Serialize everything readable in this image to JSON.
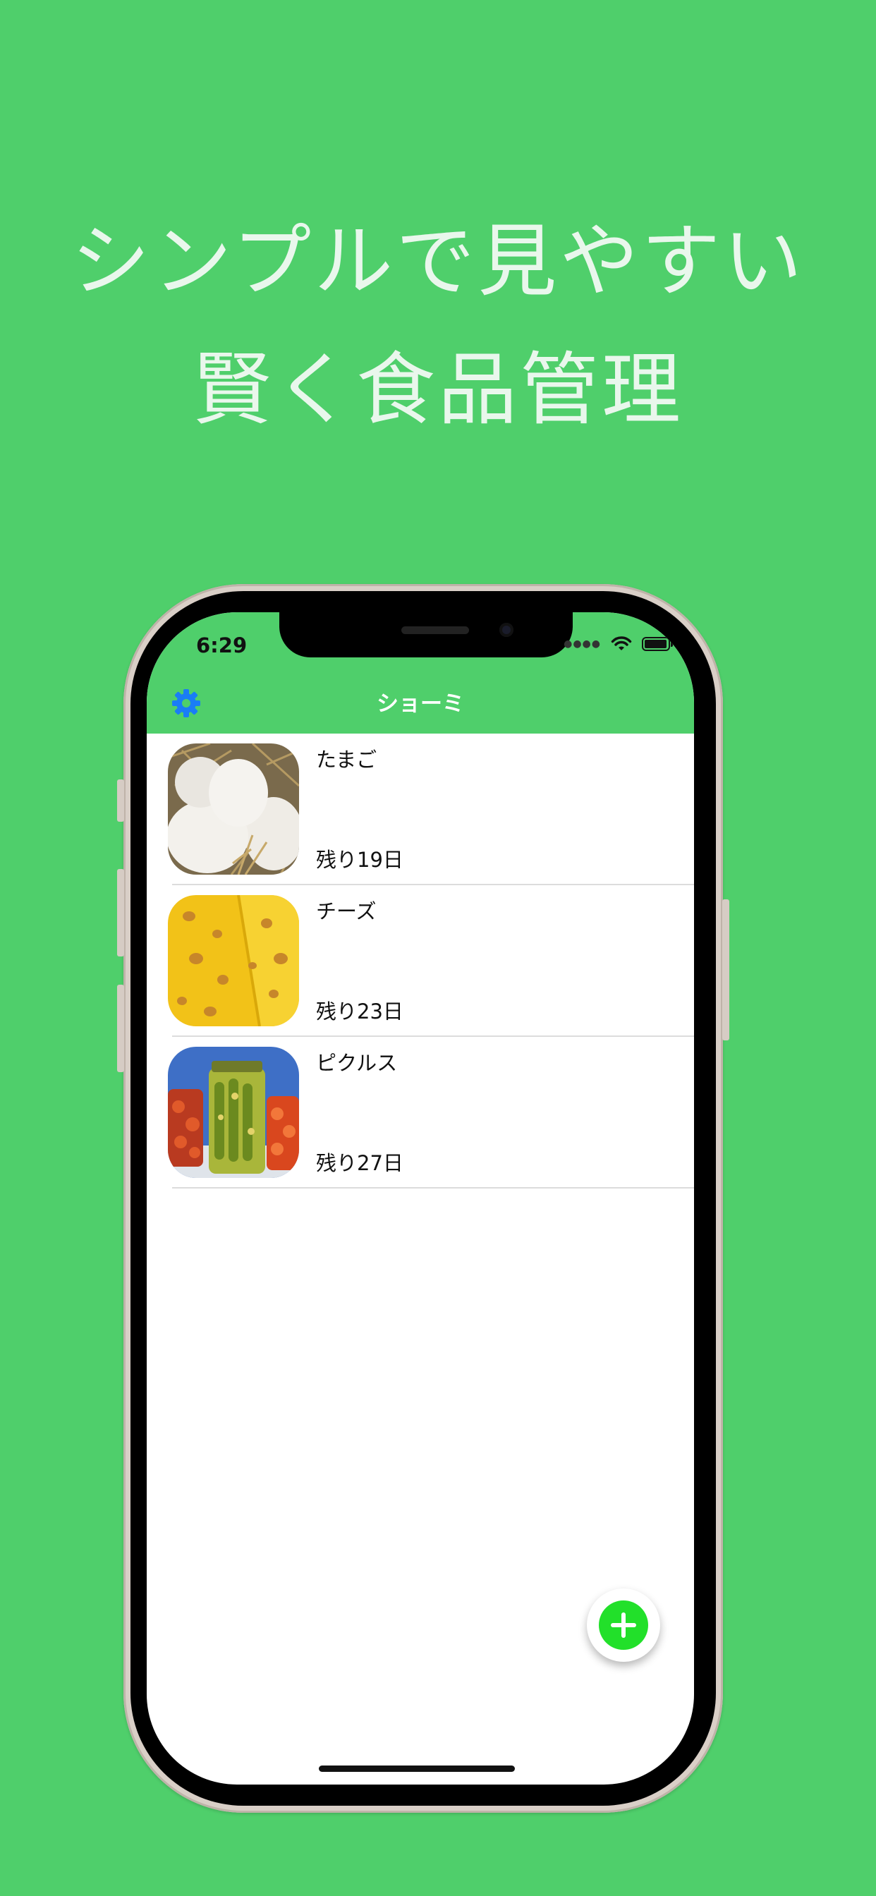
{
  "promo": {
    "line1": "シンプルで見やすい",
    "line2": "賢く食品管理"
  },
  "status_bar": {
    "time": "6:29"
  },
  "nav": {
    "title": "ショーミ",
    "settings_icon": "gear-icon"
  },
  "items": [
    {
      "name": "たまご",
      "remaining": "残り19日",
      "image": "eggs-photo"
    },
    {
      "name": "チーズ",
      "remaining": "残り23日",
      "image": "cheese-photo"
    },
    {
      "name": "ピクルス",
      "remaining": "残り27日",
      "image": "pickles-photo"
    }
  ],
  "fab": {
    "icon": "plus-icon"
  },
  "colors": {
    "background": "#4fcf6b",
    "nav_bar": "#4fcf6b",
    "settings_icon": "#1a7df5",
    "fab": "#22e02a"
  }
}
